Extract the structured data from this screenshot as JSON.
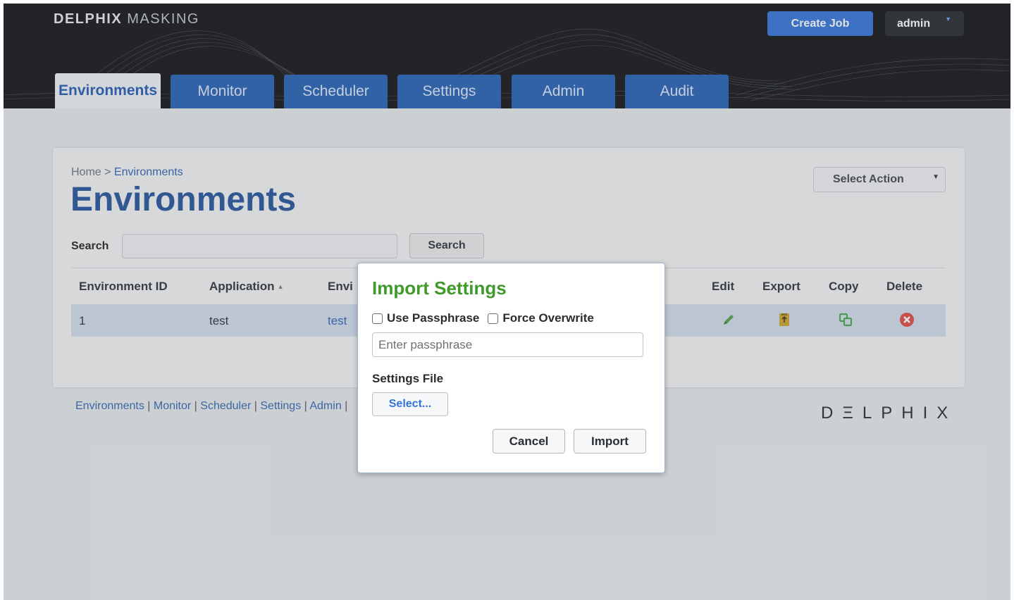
{
  "header": {
    "brand_bold": "DELPHIX",
    "brand_light": "MASKING",
    "create_job": "Create Job",
    "user": "admin"
  },
  "tabs": [
    {
      "label": "Environments",
      "active": true
    },
    {
      "label": "Monitor"
    },
    {
      "label": "Scheduler"
    },
    {
      "label": "Settings"
    },
    {
      "label": "Admin"
    },
    {
      "label": "Audit"
    }
  ],
  "breadcrumb": {
    "home": "Home",
    "sep": " > ",
    "current": "Environments"
  },
  "page_title": "Environments",
  "select_action": "Select Action",
  "search": {
    "label": "Search",
    "button": "Search",
    "value": ""
  },
  "table": {
    "headers": [
      "Environment ID",
      "Application",
      "Envi",
      "Edit",
      "Export",
      "Copy",
      "Delete"
    ],
    "rows": [
      {
        "id": "1",
        "application": "test",
        "environment": "test"
      }
    ]
  },
  "footer": {
    "links": [
      "Environments",
      "Monitor",
      "Scheduler",
      "Settings",
      "Admin"
    ],
    "separator": " | ",
    "logo": "DΞLPHIX"
  },
  "modal": {
    "title": "Import Settings",
    "use_passphrase": "Use Passphrase",
    "force_overwrite": "Force Overwrite",
    "passphrase_placeholder": "Enter passphrase",
    "settings_file_label": "Settings File",
    "select_button": "Select...",
    "cancel": "Cancel",
    "import": "Import"
  },
  "colors": {
    "brand_blue": "#1e5bb0",
    "create_job_blue": "#2d6fd6",
    "modal_title_green": "#3f9a2a",
    "delete_red": "#e0453a",
    "edit_green": "#4aa03a",
    "export_gold": "#c9a227"
  },
  "icons": [
    "edit-icon",
    "export-icon",
    "copy-icon",
    "delete-icon"
  ]
}
